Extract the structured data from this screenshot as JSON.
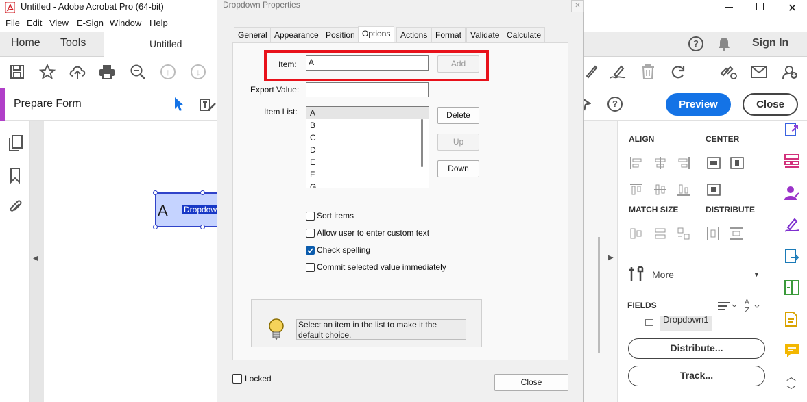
{
  "app": {
    "window_title": "Untitled - Adobe Acrobat Pro (64-bit)",
    "menu": [
      "File",
      "Edit",
      "View",
      "E-Sign",
      "Window",
      "Help"
    ],
    "tabs": {
      "home": "Home",
      "tools": "Tools",
      "document": "Untitled"
    },
    "sign_in": "Sign In",
    "prepare_form": "Prepare Form",
    "preview_btn": "Preview",
    "close_btn": "Close",
    "accent_color": "#1473e6"
  },
  "canvas": {
    "field_letter": "A",
    "field_text": "Dropdow"
  },
  "right_panel": {
    "align": "ALIGN",
    "center": "CENTER",
    "match_size": "MATCH SIZE",
    "distribute": "DISTRIBUTE",
    "more": "More",
    "fields": "FIELDS",
    "field_item": "Dropdown1",
    "distribute_btn": "Distribute...",
    "track_btn": "Track..."
  },
  "dialog": {
    "title": "Dropdown Properties",
    "tabs": [
      "General",
      "Appearance",
      "Position",
      "Options",
      "Actions",
      "Format",
      "Validate",
      "Calculate"
    ],
    "active_tab": "Options",
    "item_label": "Item:",
    "item_value": "A",
    "add_btn": "Add",
    "export_label": "Export Value:",
    "export_value": "",
    "item_list_label": "Item List:",
    "items": [
      "A",
      "B",
      "C",
      "D",
      "E",
      "F",
      "G"
    ],
    "delete_btn": "Delete",
    "up_btn": "Up",
    "down_btn": "Down",
    "options": [
      {
        "label": "Sort items",
        "checked": false
      },
      {
        "label": "Allow user to enter custom text",
        "checked": false
      },
      {
        "label": "Check spelling",
        "checked": true
      },
      {
        "label": "Commit selected value immediately",
        "checked": false
      }
    ],
    "tip_text_line1": "Select an item in the list to make it the",
    "tip_text_line2": "default choice.",
    "locked_label": "Locked",
    "close_btn": "Close",
    "highlight_color": "#e8121b"
  }
}
